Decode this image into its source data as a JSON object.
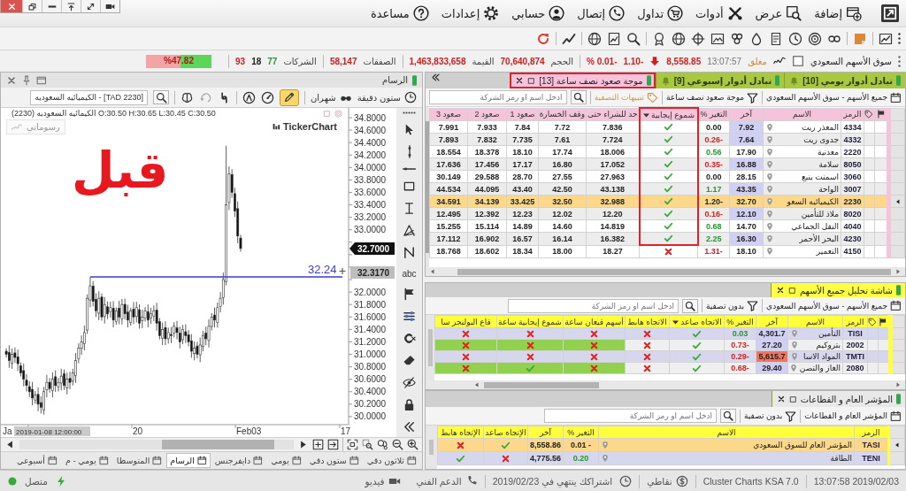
{
  "menu_bar": {
    "items": [
      "إضافة",
      "عرض",
      "أدوات",
      "تداول",
      "إتصال",
      "حسابي",
      "إعدادات",
      "مساعدة"
    ]
  },
  "market_bar": {
    "market": "سوق الأسهم السعودي",
    "status": "مغلق",
    "time": "13:07:57",
    "index": "8,558.85",
    "falling": true,
    "change": "1.10-",
    "change_percent": "% 0.01-",
    "stats": [
      {
        "label": "الحجم",
        "value": "70,640,874"
      },
      {
        "label": "القيمة",
        "value": "1,463,833,658"
      },
      {
        "label": "الصفقات",
        "value": "58,147"
      }
    ],
    "companies": {
      "label": "الشركات",
      "up": "77",
      "unchanged": "18",
      "down": "93"
    },
    "breadth": {
      "level": 0.4782,
      "reading": "%47.82"
    }
  },
  "screens": [
    {
      "tabs": [
        {
          "label": "تبادل أدوار يومي [10]",
          "selected": false,
          "highlighted": false
        },
        {
          "label": "تبادل أدوار إسبوعي [9]",
          "selected": false,
          "highlighted": false
        },
        {
          "label": "موجة صعود نصف ساعة [13]",
          "selected": true,
          "highlighted": true
        }
      ],
      "toolbar": [
        {
          "kind": "scope",
          "label": "جميع الأسهم - سوق الأسهم السعودي"
        },
        {
          "kind": "filter",
          "label": "موجة صعود نصف ساعة"
        },
        {
          "kind": "alerts",
          "label": "تنبيهات التصفية"
        }
      ],
      "search": {
        "placeholder": "ادخل اسم او رمز الشركة"
      },
      "columns": [
        {
          "label": "الرمز",
          "kind": "symbol",
          "sorted": false,
          "highlighted": false
        },
        {
          "label": "الاسم",
          "kind": "name",
          "sorted": false,
          "highlighted": false
        },
        {
          "label": "آخر",
          "kind": "last",
          "sorted": false,
          "highlighted": false
        },
        {
          "label": "التغير %",
          "kind": "change",
          "sorted": false,
          "highlighted": false
        },
        {
          "label": "شموع إيجابية",
          "kind": "signal",
          "sorted": true,
          "highlighted": true
        },
        {
          "label": "حد للشراء حتى",
          "kind": "number",
          "sorted": false,
          "highlighted": false
        },
        {
          "label": "وقف الخسارة",
          "kind": "number",
          "sorted": false,
          "highlighted": false
        },
        {
          "label": "صعود 1",
          "kind": "number",
          "sorted": false,
          "highlighted": false
        },
        {
          "label": "صعود 2",
          "kind": "number",
          "sorted": false,
          "highlighted": false
        },
        {
          "label": "صعود 3",
          "kind": "number",
          "sorted": false,
          "highlighted": false
        }
      ],
      "rows": [
        {
          "selected": false,
          "rising": false,
          "falling": false,
          "last_highlighted": true,
          "last_fell": false,
          "framed": true,
          "cells": [
            "4334",
            "المعذر ريت",
            "7.92",
            "0.00",
            {
              "met": true
            },
            "7.836",
            "7.72",
            "7.84",
            "7.933",
            "7.991"
          ]
        },
        {
          "selected": false,
          "rising": false,
          "falling": true,
          "last_highlighted": true,
          "last_fell": false,
          "framed": true,
          "cells": [
            "4332",
            "جدوى ريت",
            "7.64",
            "0.26-",
            {
              "met": true
            },
            "7.724",
            "7.61",
            "7.735",
            "7.832",
            "7.893"
          ]
        },
        {
          "selected": false,
          "rising": true,
          "falling": false,
          "last_highlighted": false,
          "last_fell": false,
          "framed": true,
          "cells": [
            "2220",
            "معدنية",
            "17.90",
            "0.56",
            {
              "met": true
            },
            "18.006",
            "17.74",
            "18.10",
            "18.378",
            "18.554"
          ]
        },
        {
          "selected": false,
          "rising": false,
          "falling": true,
          "last_highlighted": true,
          "last_fell": false,
          "framed": true,
          "cells": [
            "8050",
            "سلامة",
            "16.88",
            "0.35-",
            {
              "met": true
            },
            "17.052",
            "16.80",
            "17.17",
            "17.456",
            "17.636"
          ]
        },
        {
          "selected": false,
          "rising": false,
          "falling": false,
          "last_highlighted": false,
          "last_fell": false,
          "framed": true,
          "cells": [
            "3060",
            "اسمنت ينبع",
            "28.15",
            "0.00",
            {
              "met": true
            },
            "27.963",
            "27.55",
            "28.70",
            "29.588",
            "30.149"
          ]
        },
        {
          "selected": false,
          "rising": true,
          "falling": false,
          "last_highlighted": true,
          "last_fell": false,
          "framed": true,
          "cells": [
            "3007",
            "الواحة",
            "43.35",
            "1.17",
            {
              "met": true
            },
            "43.138",
            "42.50",
            "43.40",
            "44.095",
            "44.534"
          ]
        },
        {
          "selected": true,
          "rising": false,
          "falling": false,
          "last_highlighted": false,
          "last_fell": false,
          "framed": true,
          "cells": [
            "2230",
            "الكيميائيه السعو",
            "32.70",
            "1.20-",
            {
              "met": true
            },
            "32.988",
            "32.50",
            "33.425",
            "34.139",
            "34.591"
          ]
        },
        {
          "selected": false,
          "rising": false,
          "falling": true,
          "last_highlighted": true,
          "last_fell": false,
          "framed": true,
          "cells": [
            "8020",
            "ملاذ للتأمين",
            "12.10",
            "0.16-",
            {
              "met": true
            },
            "12.20",
            "12.02",
            "12.23",
            "12.392",
            "12.495"
          ]
        },
        {
          "selected": false,
          "rising": true,
          "falling": false,
          "last_highlighted": false,
          "last_fell": false,
          "framed": true,
          "cells": [
            "4040",
            "النقل الجماعي",
            "14.70",
            "0.68",
            {
              "met": true
            },
            "14.819",
            "14.60",
            "14.89",
            "15.114",
            "15.255"
          ]
        },
        {
          "selected": false,
          "rising": true,
          "falling": false,
          "last_highlighted": true,
          "last_fell": false,
          "framed": true,
          "cells": [
            "4230",
            "البحر الأحمر",
            "16.30",
            "2.25",
            {
              "met": true
            },
            "16.382",
            "16.14",
            "16.57",
            "16.902",
            "17.112"
          ]
        },
        {
          "selected": false,
          "rising": false,
          "falling": true,
          "last_highlighted": false,
          "last_fell": false,
          "framed": false,
          "cells": [
            "4150",
            "التعمير",
            "18.10",
            "1.31-",
            {
              "met": false
            },
            "18.27",
            "18.00",
            "18.34",
            "18.602",
            "18.768"
          ]
        }
      ]
    },
    {
      "tabs": [
        {
          "label": "شاشة تحليل جميع الأسهم",
          "selected": true,
          "highlighted": false
        }
      ],
      "toolbar": [
        {
          "kind": "scope",
          "label": "جميع الأسهم - سوق الأسهم السعودي"
        },
        {
          "kind": "filter",
          "label": "بدون تصفية"
        }
      ],
      "search": {
        "placeholder": "ادخل اسم او رمز الشركة"
      },
      "columns": [
        {
          "label": "الرمز",
          "kind": "symbol",
          "sorted": false,
          "highlighted": false
        },
        {
          "label": "الاسم",
          "kind": "name",
          "sorted": false,
          "highlighted": false
        },
        {
          "label": "آخر",
          "kind": "last",
          "sorted": false,
          "highlighted": false
        },
        {
          "label": "التغير %",
          "kind": "change",
          "sorted": false,
          "highlighted": false
        },
        {
          "label": "الاتجاه صاعد",
          "kind": "signal",
          "sorted": true,
          "highlighted": false
        },
        {
          "label": "الاتجاه هابط",
          "kind": "signal",
          "sorted": false,
          "highlighted": false
        },
        {
          "label": "أسهم قيعان ساعة",
          "kind": "signal",
          "sorted": false,
          "highlighted": false
        },
        {
          "label": "شموع إيجابية ساعة",
          "kind": "signal",
          "sorted": false,
          "highlighted": false
        },
        {
          "label": "قاع البولنجر سا",
          "kind": "signal",
          "sorted": false,
          "highlighted": false
        }
      ],
      "rows": [
        {
          "selected": false,
          "rising": true,
          "falling": false,
          "last_highlighted": true,
          "last_fell": false,
          "cells": [
            "TISI",
            "التأمين",
            "4,301.7",
            "0.03",
            {
              "met": true,
              "highlighted": false
            },
            {
              "met": false,
              "highlighted": false
            },
            {
              "met": false,
              "highlighted": false
            },
            {
              "met": false,
              "highlighted": false
            },
            {
              "met": false,
              "highlighted": false
            }
          ]
        },
        {
          "selected": false,
          "rising": false,
          "falling": true,
          "last_highlighted": true,
          "last_fell": false,
          "cells": [
            "2002",
            "بتروكيم",
            "27.20",
            "0.73-",
            {
              "met": true,
              "highlighted": false
            },
            {
              "met": false,
              "highlighted": false
            },
            {
              "met": false,
              "highlighted": true
            },
            {
              "met": false,
              "highlighted": true
            },
            {
              "met": false,
              "highlighted": true
            }
          ]
        },
        {
          "selected": false,
          "rising": false,
          "falling": true,
          "last_highlighted": false,
          "last_fell": true,
          "cells": [
            "TMTI",
            "المواد الاسا",
            "5,615.7",
            "0.29-",
            {
              "met": true,
              "highlighted": false
            },
            {
              "met": false,
              "highlighted": false
            },
            {
              "met": false,
              "highlighted": false
            },
            {
              "met": false,
              "highlighted": false
            },
            {
              "met": false,
              "highlighted": false
            }
          ]
        },
        {
          "selected": false,
          "rising": false,
          "falling": true,
          "last_highlighted": true,
          "last_fell": false,
          "cells": [
            "2080",
            "الغاز والتصن",
            "29.40",
            "0.68-",
            {
              "met": true,
              "highlighted": false
            },
            {
              "met": false,
              "highlighted": false
            },
            {
              "met": false,
              "highlighted": true
            },
            {
              "met": true,
              "highlighted": true
            },
            {
              "met": false,
              "highlighted": true
            }
          ]
        }
      ]
    },
    {
      "tabs": [
        {
          "label": "المؤشر العام و القطاعات",
          "selected": true,
          "highlighted": false
        }
      ],
      "toolbar": [
        {
          "kind": "scope",
          "label": "المؤشر العام و القطاعات"
        },
        {
          "kind": "filter",
          "label": "بدون تصفية"
        }
      ],
      "search": {
        "placeholder": "ادخل اسم او رمز الشركة"
      },
      "columns": [
        {
          "label": "الرمز",
          "kind": "symbol",
          "sorted": false,
          "highlighted": false
        },
        {
          "label": "الاسم",
          "kind": "name",
          "sorted": false,
          "highlighted": false
        },
        {
          "label": "التغير %",
          "kind": "change",
          "sorted": false,
          "highlighted": false
        },
        {
          "label": "آخر",
          "kind": "last",
          "sorted": false,
          "highlighted": false
        },
        {
          "label": "الإتجاه صاعد",
          "kind": "signal",
          "sorted": false,
          "highlighted": false
        },
        {
          "label": "الإتجاه هابط",
          "kind": "signal",
          "sorted": false,
          "highlighted": false
        }
      ],
      "rows": [
        {
          "selected": true,
          "rising": false,
          "falling": false,
          "last_highlighted": false,
          "last_fell": false,
          "cells": [
            "TASI",
            "المؤشر العام للسوق السعودي",
            "0.01 -",
            "8,558.86",
            {
              "met": true
            },
            {
              "met": false
            }
          ]
        },
        {
          "selected": false,
          "rising": true,
          "falling": false,
          "last_highlighted": false,
          "last_fell": false,
          "cells": [
            "TENI",
            "الطاقة",
            "0.20",
            "4,775.56",
            {
              "met": false
            },
            {
              "met": true
            }
          ]
        }
      ]
    }
  ],
  "chart_window": {
    "title": "الرسام",
    "interval": "ستون دقيقة",
    "period": "شهران",
    "pencil_selected": true,
    "symbol_search": "[TAD 2230] - الكيميائيه السعوديه",
    "ohlc": "الكيمائيه السعوديه (2230) O:30.50 H:30.65 L:30.45 C:30.50",
    "drawings": "رسوماتي",
    "logo": "TickerChart",
    "annotation": "قبل",
    "y_ticks_upper": [
      "34.8000",
      "34.6000",
      "34.4000",
      "34.2000",
      "34.0000",
      "33.8000",
      "33.6000",
      "33.4000",
      "33.2000",
      "33.0000"
    ],
    "y_ticks_lower": [
      "32.0000",
      "31.8000",
      "31.6000",
      "31.4000",
      "31.2000",
      "31.0000",
      "30.8000",
      "30.6000",
      "30.4000",
      "30.2000",
      "30.0000"
    ],
    "x_labels": [
      "17",
      "Feb03",
      "20",
      "Ja"
    ],
    "crosshair_time": "2019-01-08 12:00:00",
    "last_price": "32.7000",
    "cursor_price": "32.3170",
    "line_price": "32.24",
    "text_tool": "abc",
    "tabs": [
      {
        "label": "ثلاثون دقي",
        "selected": false
      },
      {
        "label": "ستون دقي",
        "selected": false
      },
      {
        "label": "يومي",
        "selected": false
      },
      {
        "label": "دايفرجنس",
        "selected": false
      },
      {
        "label": "الرسام",
        "selected": true
      },
      {
        "label": "المتوسطا",
        "selected": false
      },
      {
        "label": "يومي - م",
        "selected": false
      },
      {
        "label": "أسبوعي",
        "selected": false
      }
    ]
  },
  "status_bar": {
    "datetime": "13:07:58 2019/02/03",
    "version": "Cluster Charts KSA 7.0",
    "points": "نقاطي",
    "subscription": "اشتراكك ينتهي في 2019/02/23",
    "support": "الدعم الفني",
    "video": "فيديو",
    "connection": "متصل",
    "connected": true
  }
}
